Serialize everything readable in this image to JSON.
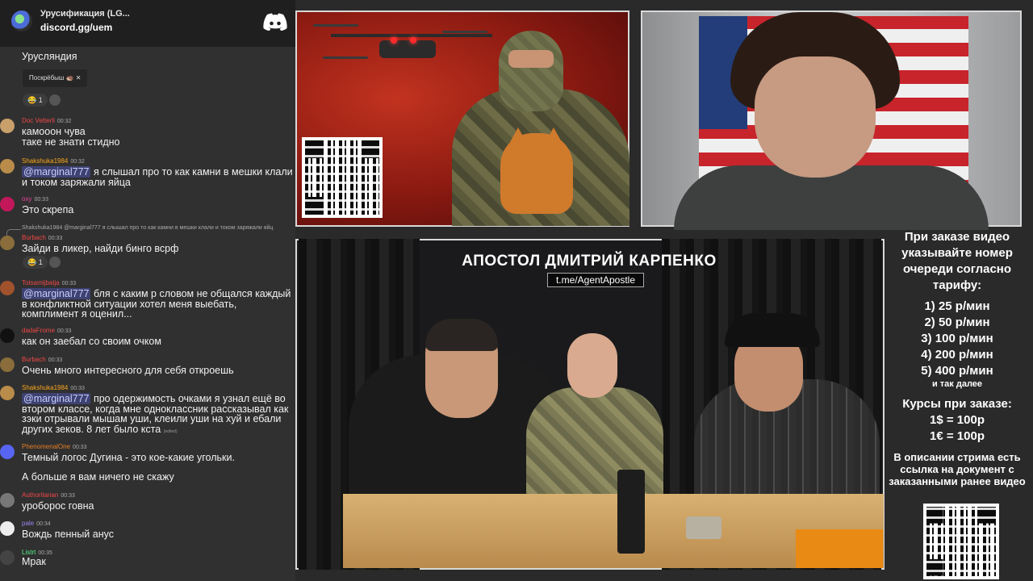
{
  "server": {
    "name": "Урусификация (LG...",
    "link": "discord.gg/uem"
  },
  "chat": {
    "top_text": "Урусляндия",
    "chip_label": "Поскрёбыш 🦔 ✕",
    "reactions_top": "😂 1",
    "messages": [
      {
        "user": "Doc Vetterli",
        "color": "#f04747",
        "time": "00:32",
        "text": "камооон чува\nтаке не знати стидно"
      },
      {
        "user": "Shakshuka1984",
        "color": "#faa61a",
        "time": "00:32",
        "mention": "@marginal777",
        "text": " я слышал про то как камни в мешки клали и током заряжали яйца"
      },
      {
        "user": "oxy",
        "color": "#eb459e",
        "time": "00:33",
        "text": "Это скрепа"
      },
      {
        "user": "Burbach",
        "color": "#f04747",
        "time": "00:33",
        "text": "Зайди в ликер, найди бинго всрф"
      },
      {
        "user": "Totsamijbatja",
        "color": "#f04747",
        "time": "00:33",
        "mention": "@marginal777",
        "text": " бля с каким р словом не общался каждый в конфликтной ситуации хотел меня выебать, комплимент я оценил..."
      },
      {
        "user": "dadaFrome",
        "color": "#f04747",
        "time": "00:33",
        "text": "как он заебал со своим очком"
      },
      {
        "user": "Burbach",
        "color": "#f04747",
        "time": "00:33",
        "text": "Очень много интересного для себя откроешь"
      },
      {
        "user": "Shakshuka1984",
        "color": "#faa61a",
        "time": "00:33",
        "mention": "@marginal777",
        "text": " про одержимость очками я узнал ещё во втором классе, когда мне одноклассник рассказывал как зэки отрывали мышам уши, клеили уши на хуй и ебали других зеков. 8 лет было кста"
      },
      {
        "user": "PhenomenalOne",
        "color": "#e67e22",
        "time": "00:33",
        "text": "Темный логос Дугина - это кое-какие угольки."
      },
      {
        "user": "",
        "color": "",
        "time": "",
        "text": "А больше я вам ничего не скажу"
      },
      {
        "user": "Authoritarian",
        "color": "#f04747",
        "time": "00:33",
        "text": "уроборос говна"
      },
      {
        "user": "pale",
        "color": "#9b84ec",
        "time": "00:34",
        "text": "Вождь пенный анус"
      },
      {
        "user": "Listrt",
        "color": "#57f287",
        "time": "00:35",
        "text": "Мрак"
      }
    ],
    "reply_preview": "Shakshuka1984 @marginal777 я слышал про то как камни в мешки клали и током заряжали яйц",
    "reaction_burbach": "😂 1",
    "edited": "(edited)"
  },
  "video": {
    "title": "АПОСТОЛ ДМИТРИЙ КАРПЕНКО",
    "link": "t.me/AgentApostle"
  },
  "info": {
    "header": "При заказе видео указывайте номер очереди согласно тарифу:",
    "tariffs": [
      "1) 25 р/мин",
      "2) 50 р/мин",
      "3) 100 р/мин",
      "4) 200 р/мин",
      "5) 400 р/мин"
    ],
    "etc": "и так далее",
    "rates_title": "Курсы при заказе:",
    "rates": [
      "1$ = 100р",
      "1€ = 100р"
    ],
    "footer": "В описании стрима есть ссылка на документ с заказанными ранее видео"
  },
  "colors": {
    "chat_bg": "#303030",
    "mention_bg": "#5865f2",
    "panel_border": "#d8d8d8"
  }
}
